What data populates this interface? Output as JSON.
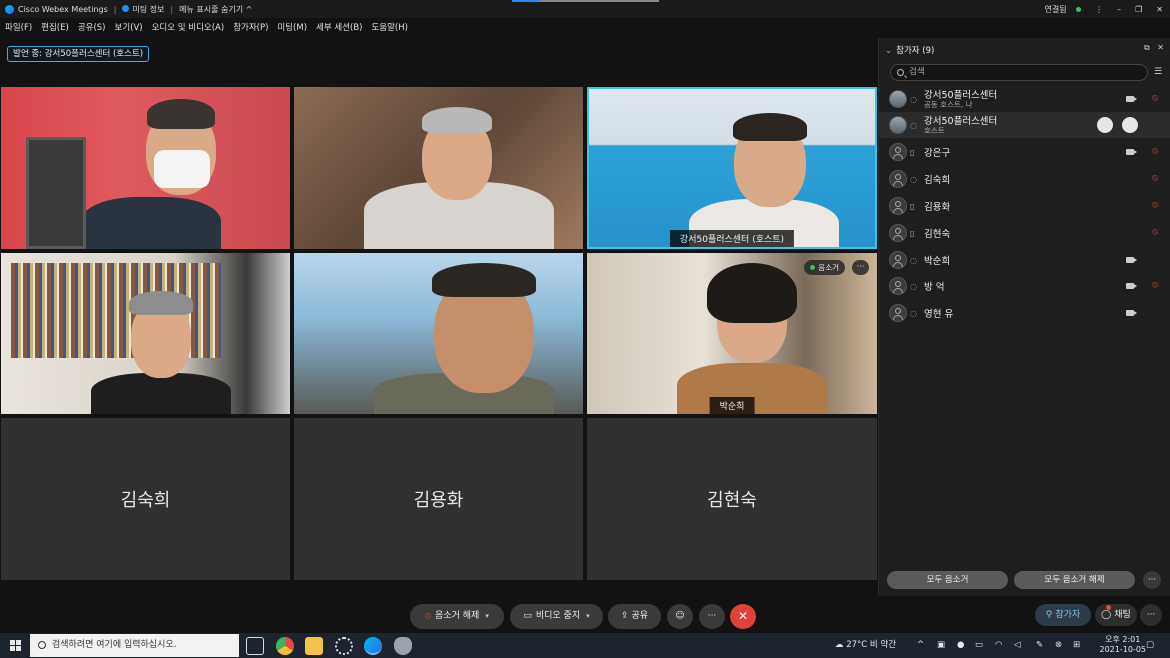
{
  "window": {
    "app_title": "Cisco Webex Meetings",
    "meeting_info": "미팅 정보",
    "hide_menu": "메뉴 표시줄 숨기기",
    "hide_menu_chevron": "^",
    "connection": "연결됨",
    "btn_min": "–",
    "btn_max": "❐",
    "btn_close": "✕"
  },
  "menu": {
    "items": [
      "파일(F)",
      "편집(E)",
      "공유(S)",
      "보기(V)",
      "오디오 및 비디오(A)",
      "참가자(P)",
      "미팅(M)",
      "세부 세션(B)",
      "도움말(H)"
    ]
  },
  "speaker_badge": "발언 중: 강서50플러스센터 (호스트)",
  "tiles": {
    "t3_name": "강서50플러스센터 (호스트)",
    "t6_name": "박순희",
    "t6_mute": "음소거",
    "t6_more": "···",
    "t7_name": "김숙희",
    "t8_name": "김용화",
    "t9_name": "김현숙"
  },
  "panel": {
    "title": "참가자 (9)",
    "search_placeholder": "검색",
    "participants": [
      {
        "name": "강서50플러스센터",
        "role": "공동 호스트, 나"
      },
      {
        "name": "강서50플러스센터",
        "role": "호스트"
      },
      {
        "name": "강은구"
      },
      {
        "name": "김숙희"
      },
      {
        "name": "김용화"
      },
      {
        "name": "김현숙"
      },
      {
        "name": "박순희"
      },
      {
        "name": "방 억"
      },
      {
        "name": "영현 유"
      }
    ],
    "mute_all": "모두 음소거",
    "unmute_all": "모두 음소거 해제",
    "more": "···"
  },
  "controls": {
    "unmute": "음소거 해제",
    "stop_video": "비디오 중지",
    "share": "공유",
    "reactions": "☺",
    "more": "···",
    "end": "✕",
    "participants_tab": "참가자",
    "chat_tab": "채팅",
    "side_more": "···"
  },
  "taskbar": {
    "search_placeholder": "검색하려면 여기에 입력하십시오.",
    "weather": "27°C 비 약간",
    "time": "오후 2:01",
    "date": "2021-10-05"
  },
  "colors": {
    "accent": "#3cc3e8",
    "mute_red": "#e84a3c",
    "end_red": "#e0413a",
    "connected_green": "#3cc35f"
  }
}
